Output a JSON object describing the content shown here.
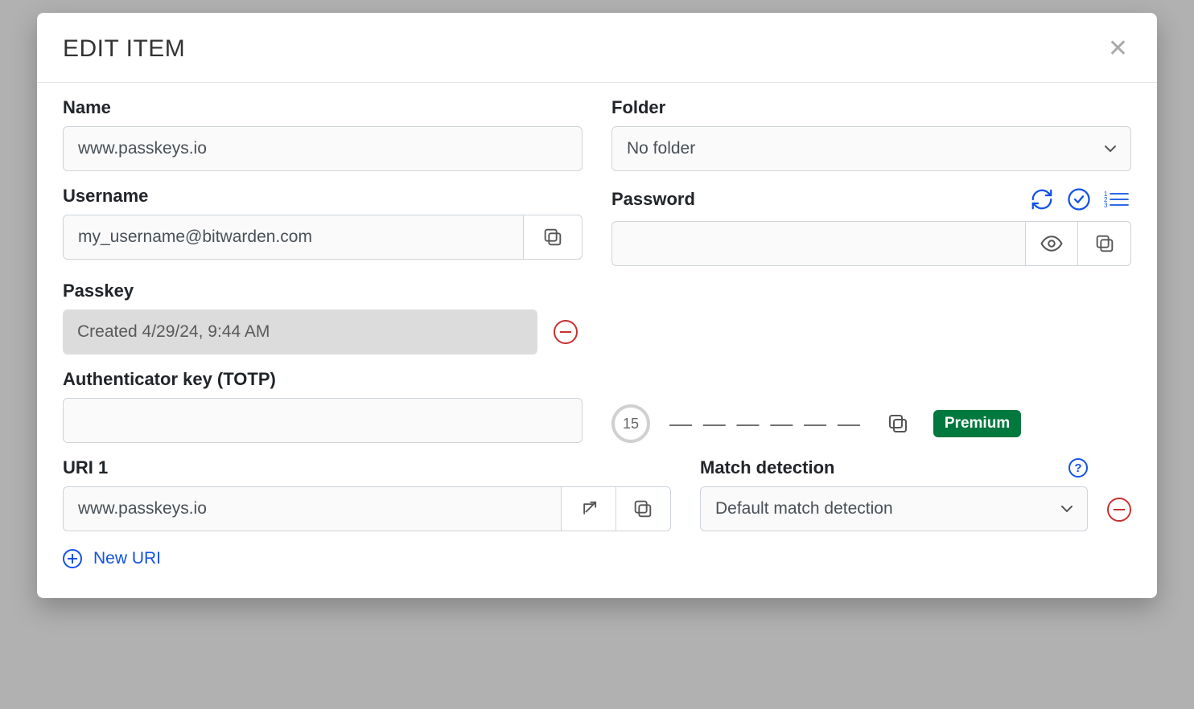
{
  "modal": {
    "title": "Edit Item"
  },
  "fields": {
    "name": {
      "label": "Name",
      "value": "www.passkeys.io"
    },
    "folder": {
      "label": "Folder",
      "value": "No folder"
    },
    "username": {
      "label": "Username",
      "value": "my_username@bitwarden.com"
    },
    "password": {
      "label": "Password",
      "value": ""
    },
    "passkey": {
      "label": "Passkey",
      "created_text": "Created 4/29/24, 9:44 AM"
    },
    "totp": {
      "label": "Authenticator key (TOTP)",
      "value": "",
      "seconds": "15",
      "code": "— — —   — — —",
      "badge": "Premium"
    },
    "uri1": {
      "label": "URI 1",
      "value": "www.passkeys.io"
    },
    "match": {
      "label": "Match detection",
      "value": "Default match detection"
    }
  },
  "actions": {
    "new_uri": "New URI"
  }
}
